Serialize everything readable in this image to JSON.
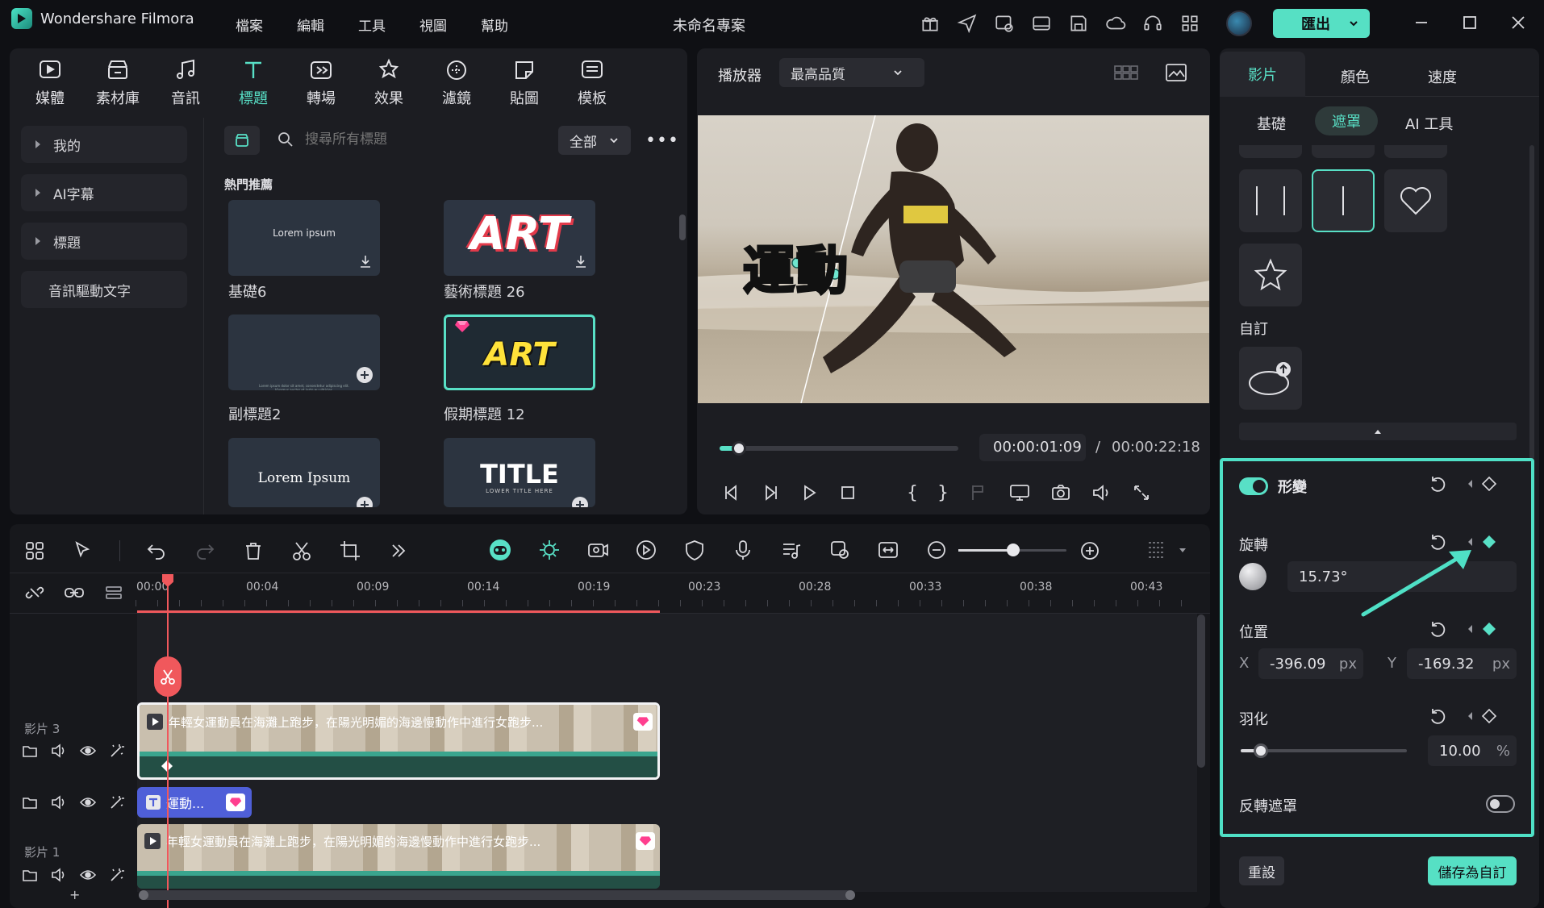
{
  "app": {
    "name": "Wondershare Filmora",
    "project_title": "未命名專案",
    "export_label": "匯出"
  },
  "menu": [
    "檔案",
    "編輯",
    "工具",
    "視圖",
    "幫助"
  ],
  "tool_tabs": [
    {
      "label": "媒體",
      "icon": "media-icon"
    },
    {
      "label": "素材庫",
      "icon": "stock-icon"
    },
    {
      "label": "音訊",
      "icon": "audio-icon"
    },
    {
      "label": "標題",
      "icon": "title-icon"
    },
    {
      "label": "轉場",
      "icon": "transition-icon"
    },
    {
      "label": "效果",
      "icon": "effects-icon"
    },
    {
      "label": "濾鏡",
      "icon": "filter-icon"
    },
    {
      "label": "貼圖",
      "icon": "sticker-icon"
    },
    {
      "label": "模板",
      "icon": "template-icon"
    }
  ],
  "library_sidebar": [
    "我的",
    "AI字幕",
    "標題",
    "音訊驅動文字"
  ],
  "library": {
    "search_placeholder": "搜尋所有標題",
    "filter_value": "全部",
    "section_title": "熱門推薦",
    "items": [
      {
        "label": "基礎6",
        "preview": "Lorem ipsum"
      },
      {
        "label": "藝術標題 26",
        "preview": "ART"
      },
      {
        "label": "副標題2",
        "preview": "Lorem ipsum dolor sit amet, consectetur adipiscing elit. Vivamus auctor et justo eu ultricies."
      },
      {
        "label": "假期標題 12",
        "preview": "ART"
      },
      {
        "label": "",
        "preview": "Lorem Ipsum"
      },
      {
        "label": "",
        "preview": "TITLE",
        "preview_sub": "LOWER TITLE HERE"
      }
    ]
  },
  "player": {
    "label": "播放器",
    "quality": "最高品質",
    "overlay_text": "運動",
    "current_time": "00:00:01:09",
    "separator": "/",
    "total_time": "00:00:22:18",
    "progress": 0.08
  },
  "right_panel": {
    "tabs": [
      "影片",
      "顏色",
      "速度"
    ],
    "subtabs": [
      "基礎",
      "遮罩",
      "AI 工具"
    ],
    "custom_label": "自訂",
    "transform": {
      "label": "形變",
      "enabled": true
    },
    "rotation": {
      "label": "旋轉",
      "value": "15.73°"
    },
    "position": {
      "label": "位置",
      "x_label": "X",
      "x_value": "-396.09",
      "y_label": "Y",
      "y_value": "-169.32",
      "unit": "px"
    },
    "feather": {
      "label": "羽化",
      "value": "10.00",
      "unit": "%",
      "level": 0.12
    },
    "invert": {
      "label": "反轉遮罩",
      "enabled": false
    },
    "reset_label": "重設",
    "save_label": "儲存為自訂"
  },
  "timeline": {
    "ruler": [
      "00:00",
      "00:04",
      "00:09",
      "00:14",
      "00:19",
      "00:23",
      "00:28",
      "00:33",
      "00:38",
      "00:43"
    ],
    "tracks": [
      {
        "name": "影片 3",
        "clip_title": "年輕女運動員在海灘上跑步，在陽光明媚的海邊慢動作中進行女跑步..."
      },
      {
        "name": "",
        "clip_title": "運動..."
      },
      {
        "name": "影片 1",
        "clip_title": "年輕女運動員在海灘上跑步，在陽光明媚的海邊慢動作中進行女跑步..."
      }
    ]
  },
  "colors": {
    "accent": "#58e0c6",
    "playhead": "#f0585c",
    "bg": "#0f1014",
    "panel": "#1c1d22"
  }
}
